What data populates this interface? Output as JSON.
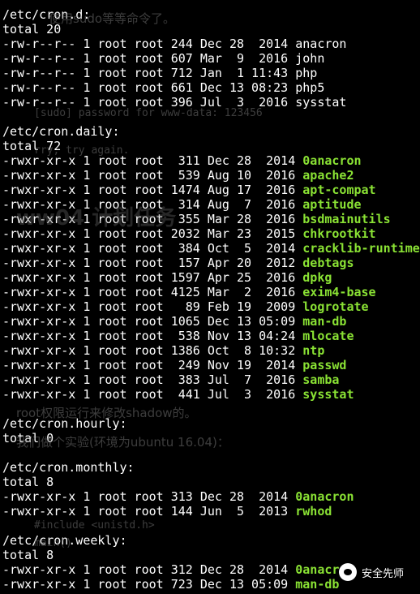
{
  "terminal": {
    "lines": [
      {
        "text": "/etc/cron.d:"
      },
      {
        "text": "total 20"
      },
      {
        "text": "-rw-r--r-- 1 root root 244 Dec 28  2014 anacron"
      },
      {
        "text": "-rw-r--r-- 1 root root 607 Mar  9  2016 john"
      },
      {
        "text": "-rw-r--r-- 1 root root 712 Jan  1 11:43 php"
      },
      {
        "text": "-rw-r--r-- 1 root root 661 Dec 13 08:23 php5"
      },
      {
        "text": "-rw-r--r-- 1 root root 396 Jul  3  2016 sysstat"
      },
      {
        "text": ""
      },
      {
        "text": "/etc/cron.daily:"
      },
      {
        "text": "total 72"
      },
      {
        "text": "-rwxr-xr-x 1 root root  311 Dec 28  2014 ",
        "exe": "0anacron"
      },
      {
        "text": "-rwxr-xr-x 1 root root  539 Aug 10  2016 ",
        "exe": "apache2"
      },
      {
        "text": "-rwxr-xr-x 1 root root 1474 Aug 17  2016 ",
        "exe": "apt-compat"
      },
      {
        "text": "-rwxr-xr-x 1 root root  314 Aug  7  2016 ",
        "exe": "aptitude"
      },
      {
        "text": "-rwxr-xr-x 1 root root  355 Mar 28  2016 ",
        "exe": "bsdmainutils"
      },
      {
        "text": "-rwxr-xr-x 1 root root 2032 Mar 23  2015 ",
        "exe": "chkrootkit"
      },
      {
        "text": "-rwxr-xr-x 1 root root  384 Oct  5  2014 ",
        "exe": "cracklib-runtime"
      },
      {
        "text": "-rwxr-xr-x 1 root root  157 Apr 20  2012 ",
        "exe": "debtags"
      },
      {
        "text": "-rwxr-xr-x 1 root root 1597 Apr 25  2016 ",
        "exe": "dpkg"
      },
      {
        "text": "-rwxr-xr-x 1 root root 4125 Mar  2  2016 ",
        "exe": "exim4-base"
      },
      {
        "text": "-rwxr-xr-x 1 root root   89 Feb 19  2009 ",
        "exe": "logrotate"
      },
      {
        "text": "-rwxr-xr-x 1 root root 1065 Dec 13 05:09 ",
        "exe": "man-db"
      },
      {
        "text": "-rwxr-xr-x 1 root root  538 Nov 13 04:24 ",
        "exe": "mlocate"
      },
      {
        "text": "-rwxr-xr-x 1 root root 1386 Oct  8 10:32 ",
        "exe": "ntp"
      },
      {
        "text": "-rwxr-xr-x 1 root root  249 Nov 19  2014 ",
        "exe": "passwd"
      },
      {
        "text": "-rwxr-xr-x 1 root root  383 Jul  7  2016 ",
        "exe": "samba"
      },
      {
        "text": "-rwxr-xr-x 1 root root  441 Jul  3  2016 ",
        "exe": "sysstat"
      },
      {
        "text": ""
      },
      {
        "text": "/etc/cron.hourly:"
      },
      {
        "text": "total 0"
      },
      {
        "text": ""
      },
      {
        "text": "/etc/cron.monthly:"
      },
      {
        "text": "total 8"
      },
      {
        "text": "-rwxr-xr-x 1 root root 313 Dec 28  2014 ",
        "exe": "0anacron"
      },
      {
        "text": "-rwxr-xr-x 1 root root 144 Jun  5  2013 ",
        "exe": "rwhod"
      },
      {
        "text": ""
      },
      {
        "text": "/etc/cron.weekly:"
      },
      {
        "text": "total 8"
      },
      {
        "text": "-rwxr-xr-x 1 root root 312 Dec 28  2014 ",
        "exe": "0anacron"
      },
      {
        "text": "-rwxr-xr-x 1 root root 723 Dec 13 05:09 ",
        "exe": "man-db"
      }
    ]
  },
  "background_ghost": {
    "line1": "使用sudo等等命令了。",
    "line2": "[sudo] password for www-data: 123456",
    "line3": "rry, try again.",
    "line4": "ww04 计划任务",
    "line5": "root权限运行来修改shadow的。",
    "line6": "我们做个实验(环境为ubuntu 16.04)：",
    "line7": "#include <unistd.h>",
    "line8": "main()"
  },
  "watermark": {
    "text": "安全先师"
  },
  "colors": {
    "background": "#000000",
    "text": "#ffffff",
    "executable": "#8ae234"
  }
}
